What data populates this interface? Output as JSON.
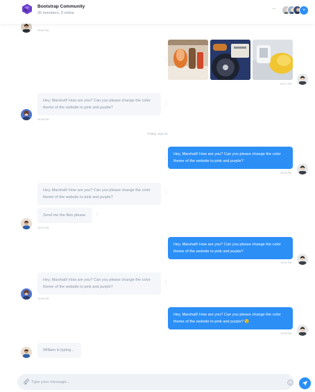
{
  "header": {
    "title": "Bootstrap Community",
    "subtitle": "35 members, 3 online",
    "more_count": "+",
    "menu_icon": "more-horizontal-icon"
  },
  "colors": {
    "accent": "#2b8ff6",
    "incoming_bubble": "#f4f6fa",
    "logo": "#6b3fc9"
  },
  "messages": {
    "top_time": "09:46 PM",
    "photos_time": "09:47 PM",
    "m1_text": "Hey, Marshall! How are you? Can you please change the color theme of the website to pink and purple?",
    "m1_time": "09:46 PM",
    "date_divider": "Friday, Sep 20",
    "m2_text": "Hey, Marshall! How are you? Can you please change the color theme of the website to pink and purple?",
    "m2_time": "09:46 PM",
    "m3_text": "Hey, Marshall! How are you? Can you please change the color theme of the website to pink and purple?",
    "m4_text": "Send me the files please",
    "m4_time": "10:01 PM",
    "m5_text": "Hey, Marshall! How are you? Can you please change the color theme of the website to pink and purple?",
    "m5_time": "10:01 PM",
    "m6_text": "Hey, Marshall! How are you? Can you please change the color theme of the website to pink and purple?",
    "m6_time": "10:05 PM",
    "m7_text": "Hey, Marshall! How are you? Can you please change the color theme of the website to pink and purple? 😉",
    "m7_time": "10:05 PM",
    "typing_text": "William is typing..."
  },
  "composer": {
    "placeholder": "Type your message..."
  }
}
